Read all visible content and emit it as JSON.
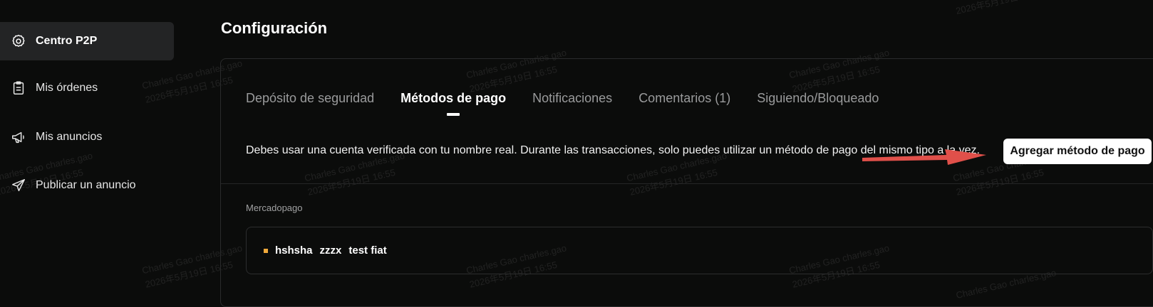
{
  "sidebar": {
    "items": [
      {
        "label": "Centro P2P",
        "icon": "gear-icon",
        "active": true
      },
      {
        "label": "Mis órdenes",
        "icon": "clipboard-icon",
        "active": false
      },
      {
        "label": "Mis anuncios",
        "icon": "megaphone-icon",
        "active": false
      },
      {
        "label": "Publicar un anuncio",
        "icon": "paper-plane-icon",
        "active": false
      }
    ]
  },
  "page": {
    "title": "Configuración"
  },
  "tabs": [
    {
      "label": "Depósito de seguridad",
      "active": false
    },
    {
      "label": "Métodos de pago",
      "active": true
    },
    {
      "label": "Notificaciones",
      "active": false
    },
    {
      "label": "Comentarios (1)",
      "active": false
    },
    {
      "label": "Siguiendo/Bloqueado",
      "active": false
    }
  ],
  "payment": {
    "notice": "Debes usar una cuenta verificada con tu nombre real. Durante las transacciones, solo puedes utilizar un método de pago del mismo tipo a la vez.",
    "add_button": "Agregar método de pago",
    "section_label": "Mercadopago",
    "method": {
      "name": "hshsha",
      "account": "zzzx",
      "note": "test fiat"
    }
  },
  "watermark": {
    "name": "Charles Gao charles.gao",
    "date": "2026年5月19日 16:55"
  },
  "colors": {
    "background": "#0b0c0b",
    "active_nav": "#232425",
    "accent_dot": "#f0a93b",
    "annotation_arrow": "#e0504a"
  }
}
